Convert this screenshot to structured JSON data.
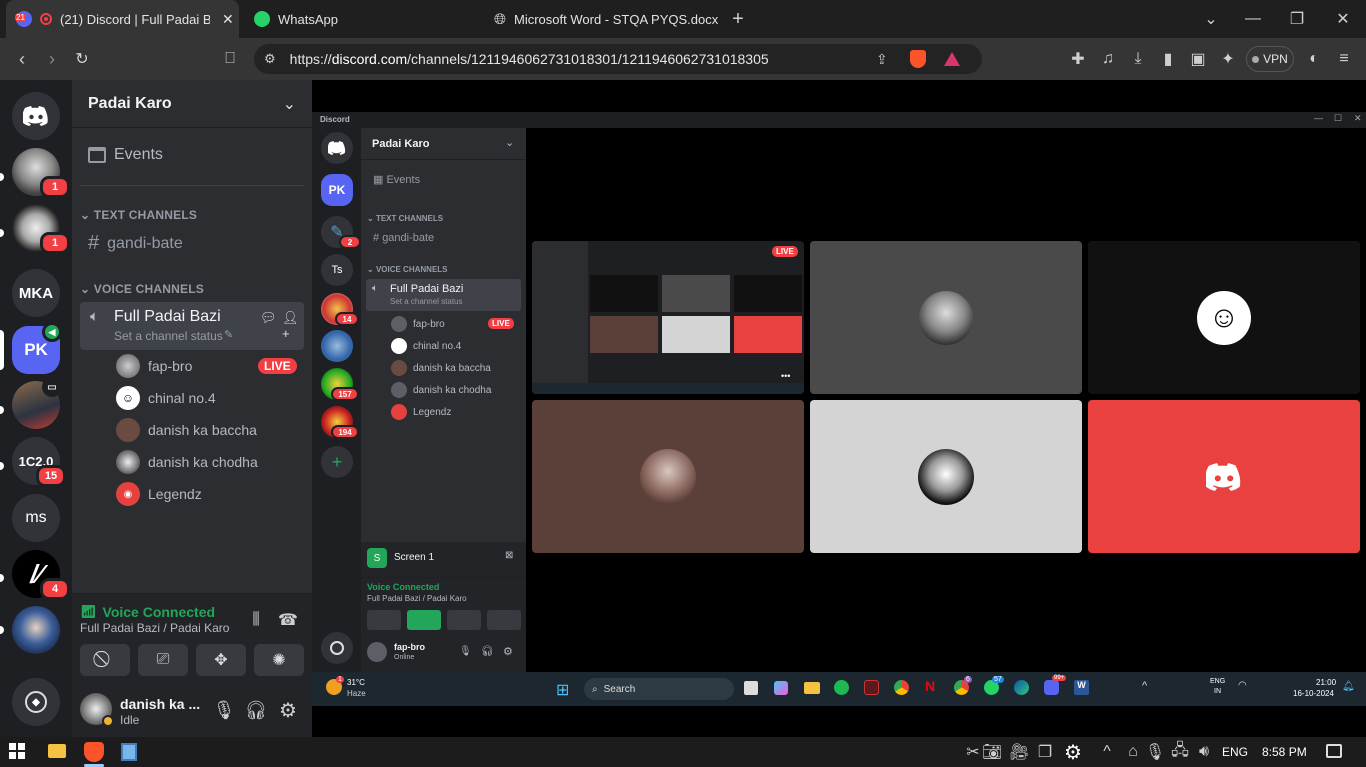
{
  "browser": {
    "tabs": [
      {
        "label": "(21) Discord | Full Padai Bazi",
        "badge": "21"
      },
      {
        "label": "WhatsApp"
      },
      {
        "label": "Microsoft Word - STQA PYQS.docx"
      }
    ],
    "url_prefix": "https://",
    "url_domain": "discord.com",
    "url_path": "/channels/1211946062731018301/1211946062731018305",
    "vpn_label": "VPN"
  },
  "guilds": [
    {
      "label": "",
      "badge": "1"
    },
    {
      "label": "",
      "badge": "1"
    },
    {
      "label": "MKA"
    },
    {
      "label": "PK"
    },
    {
      "label": ""
    },
    {
      "label": "1C2.0",
      "badge": "15"
    },
    {
      "label": "ms"
    },
    {
      "label": "",
      "badge": "4"
    },
    {
      "label": ""
    }
  ],
  "server": {
    "name": "Padai Karo",
    "events_label": "Events",
    "text_category": "TEXT CHANNELS",
    "text_channel": "gandi-bate",
    "voice_category": "VOICE CHANNELS",
    "voice_channel": "Full Padai Bazi",
    "channel_status": "Set a channel status",
    "members": [
      {
        "name": "fap-bro",
        "live": "LIVE"
      },
      {
        "name": "chinal no.4"
      },
      {
        "name": "danish ka baccha"
      },
      {
        "name": "danish ka chodha"
      },
      {
        "name": "Legendz"
      }
    ]
  },
  "voice_panel": {
    "status": "Voice Connected",
    "location": "Full Padai Bazi / Padai Karo"
  },
  "user": {
    "name": "danish ka ...",
    "status": "Idle"
  },
  "inner": {
    "app_title": "Discord",
    "guild_pk": "PK",
    "guild_ts": "Ts",
    "guild_badges": [
      "2",
      "14",
      "157",
      "194"
    ],
    "server_name": "Padai Karo",
    "events_label": "Events",
    "text_category": "TEXT CHANNELS",
    "text_channel": "gandi-bate",
    "voice_category": "VOICE CHANNELS",
    "voice_channel": "Full Padai Bazi",
    "channel_status": "Set a channel status",
    "members": [
      {
        "name": "fap-bro",
        "live": "LIVE"
      },
      {
        "name": "chinal no.4"
      },
      {
        "name": "danish ka baccha"
      },
      {
        "name": "danish ka chodha"
      },
      {
        "name": "Legendz"
      }
    ],
    "screen_label": "Screen 1",
    "voice_status": "Voice Connected",
    "voice_location": "Full Padai Bazi / Padai Karo",
    "user_name": "fap-bro",
    "user_status": "Online",
    "live_badge": "LIVE",
    "more_label": "•••",
    "taskbar": {
      "weather_temp": "31°C",
      "weather_desc": "Haze",
      "weather_badge": "1",
      "search": "Search",
      "lang1": "ENG",
      "lang2": "IN",
      "time": "21:00",
      "date": "16-10-2024",
      "badge_1": "6",
      "badge_2": "57",
      "badge_3": "99+"
    }
  },
  "taskbar": {
    "lang": "ENG",
    "time": "8:58 PM"
  },
  "colors": {
    "accent": "#5865f2",
    "green": "#23a55a",
    "red": "#f23f43",
    "tile_red": "#e8413f"
  }
}
